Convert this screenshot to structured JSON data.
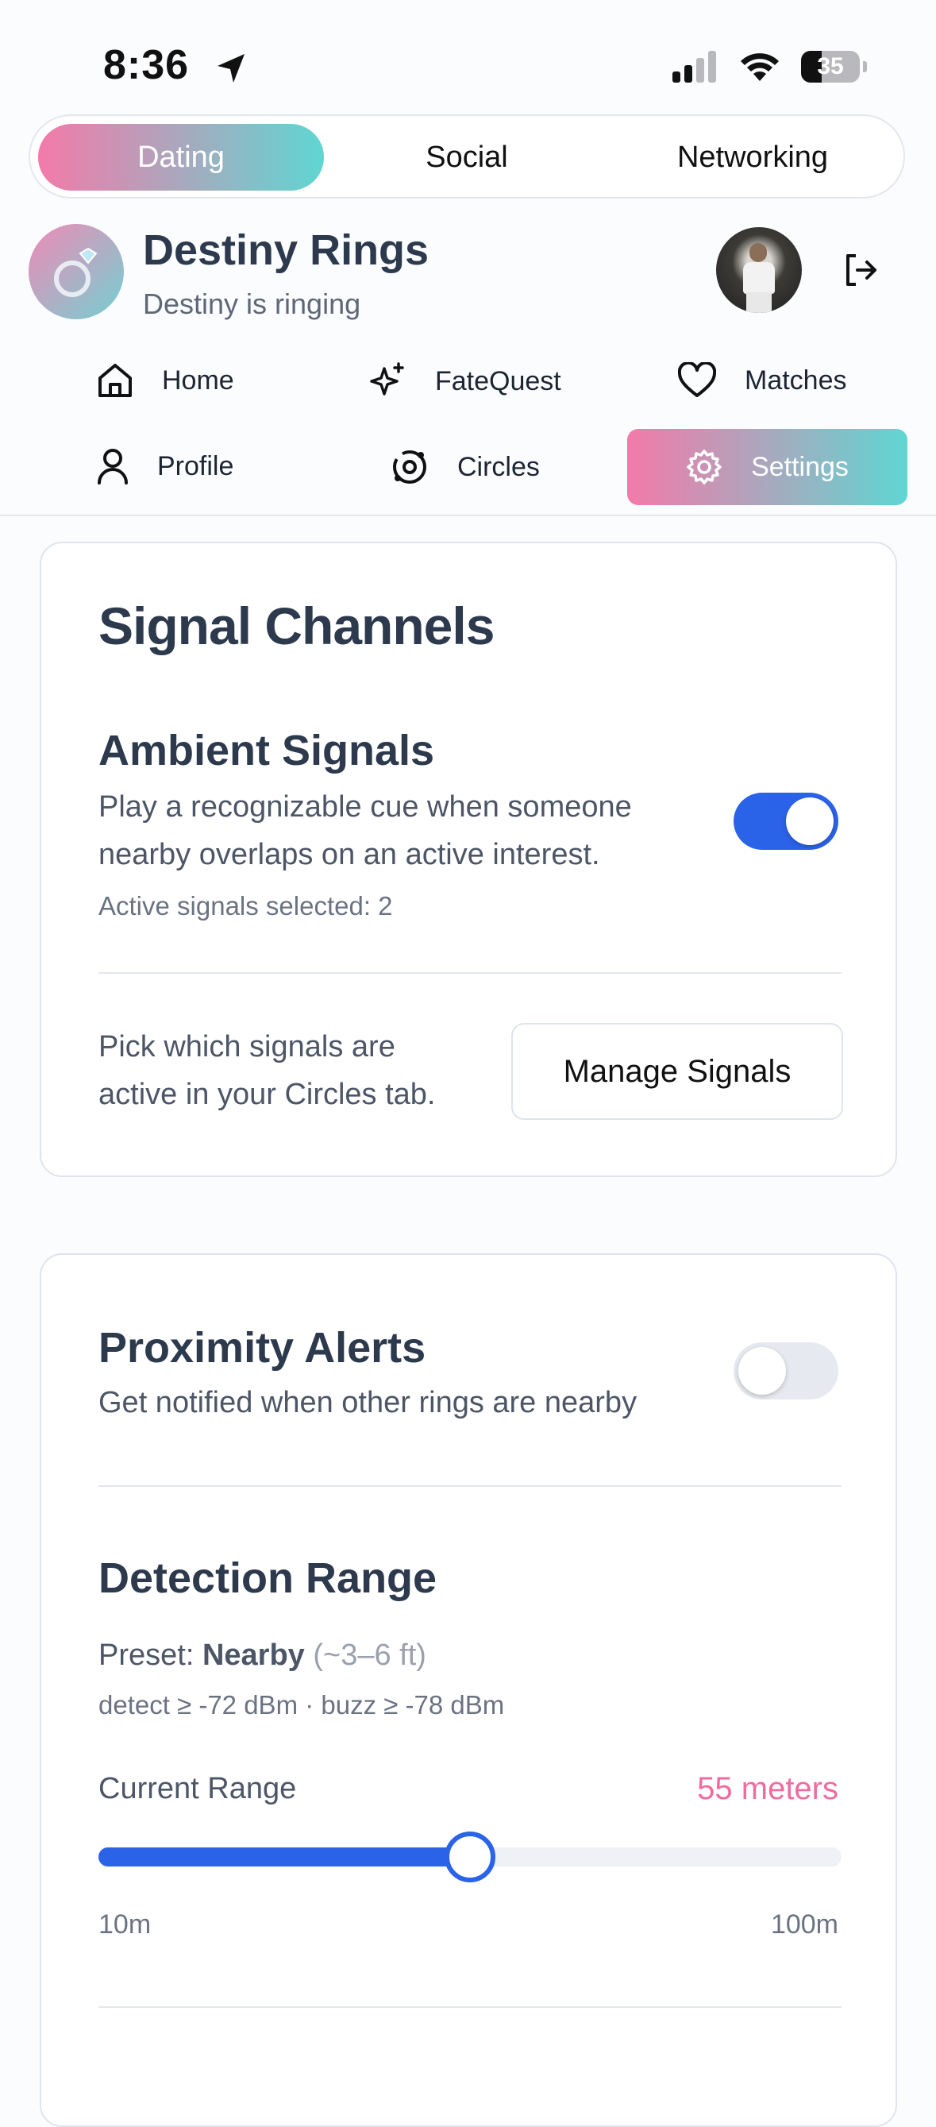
{
  "status_bar": {
    "time": "8:36",
    "battery": "35"
  },
  "mode_tabs": [
    {
      "label": "Dating",
      "active": true
    },
    {
      "label": "Social",
      "active": false
    },
    {
      "label": "Networking",
      "active": false
    }
  ],
  "header": {
    "title": "Destiny Rings",
    "subtitle": "Destiny is ringing"
  },
  "nav": {
    "home": "Home",
    "fatequest": "FateQuest",
    "matches": "Matches",
    "profile": "Profile",
    "circles": "Circles",
    "settings": "Settings",
    "active": "Settings"
  },
  "signal_channels": {
    "title": "Signal Channels",
    "ambient_title": "Ambient Signals",
    "ambient_desc_line1": "Play a recognizable cue when someone",
    "ambient_desc_line2": "nearby overlaps on an active interest.",
    "ambient_enabled": true,
    "active_count_text": "Active signals selected: 2",
    "pick_line1": "Pick which signals are",
    "pick_line2": "active in your Circles tab.",
    "manage_button": "Manage Signals"
  },
  "proximity": {
    "title": "Proximity Alerts",
    "desc": "Get notified when other rings are nearby",
    "enabled": false,
    "range_title": "Detection Range",
    "preset_label": "Preset:",
    "preset_value": "Nearby",
    "preset_hint": "(~3–6 ft)",
    "thresholds": "detect ≥ -72 dBm · buzz ≥ -78 dBm",
    "current_label": "Current Range",
    "current_value_text": "55 meters",
    "range_value": 55,
    "range_min": 10,
    "range_max": 100,
    "min_label": "10m",
    "max_label": "100m"
  },
  "colors": {
    "accent_blue": "#2b63e8",
    "accent_pink": "#f06ba0",
    "gradient_start": "#f37aa9",
    "gradient_end": "#5fd6d2"
  }
}
